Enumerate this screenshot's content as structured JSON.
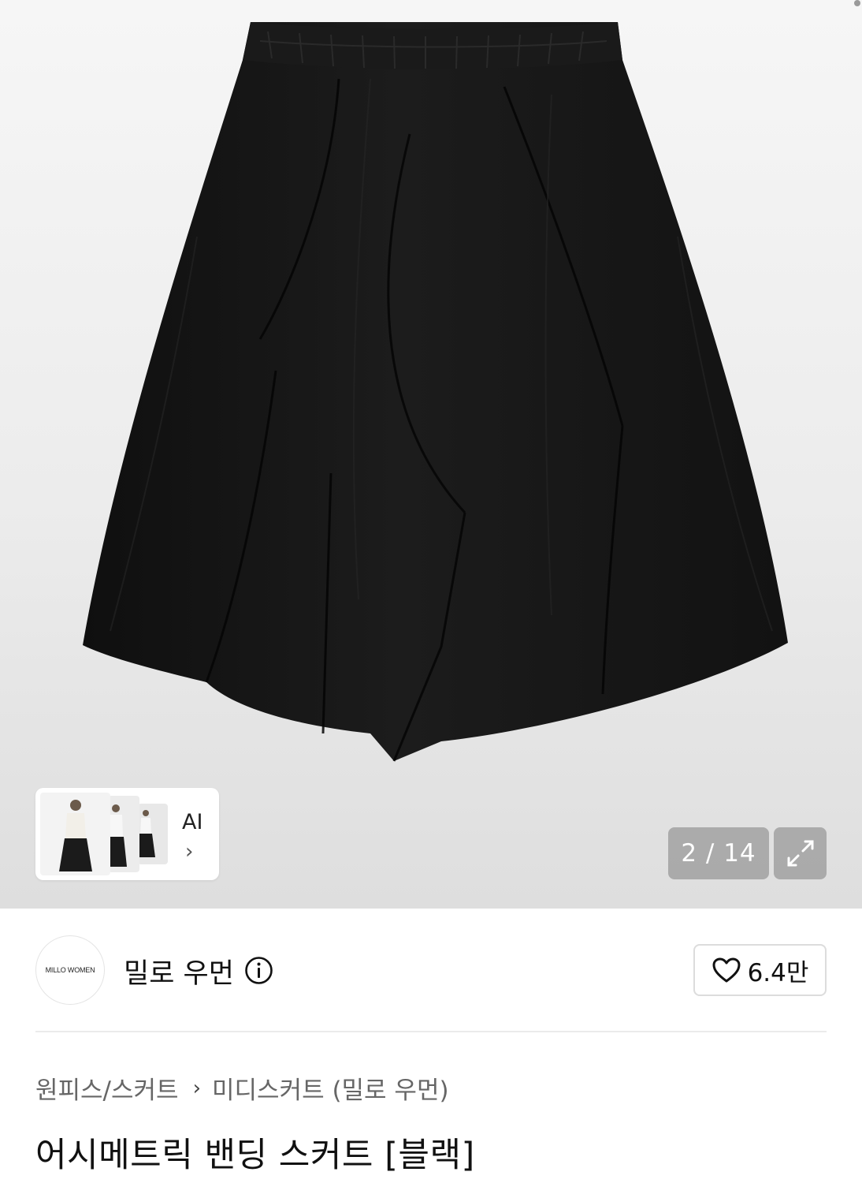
{
  "gallery": {
    "current": "2",
    "separator": "/",
    "total": "14",
    "counter_text": "2 / 14",
    "expand_icon": "expand-icon",
    "background": "#ececec"
  },
  "ai_card": {
    "label": "AI",
    "chevron": "›"
  },
  "brand": {
    "logo_text": "MILLO WOMEN",
    "name": "밀로 우먼",
    "info_icon": "info-icon"
  },
  "like": {
    "icon": "heart-icon",
    "count": "6.4만"
  },
  "breadcrumb": {
    "category": "원피스/스커트",
    "separator": "›",
    "subcategory": "미디스커트 (밀로 우먼)"
  },
  "product": {
    "title": "어시메트릭 밴딩 스커트 [블랙]",
    "color": "#151515"
  }
}
